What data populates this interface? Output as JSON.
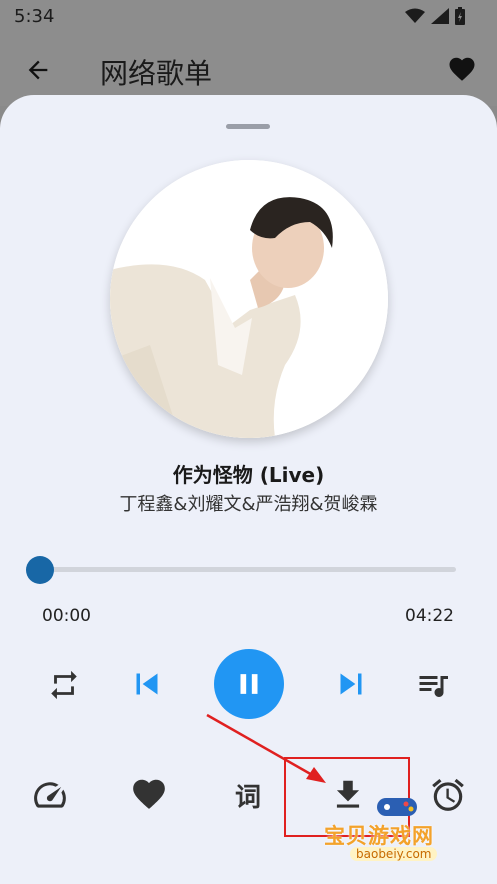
{
  "status": {
    "time": "5:34"
  },
  "header": {
    "title": "网络歌单"
  },
  "song": {
    "title": "作为怪物 (Live)",
    "artist": "丁程鑫&刘耀文&严浩翔&贺峻霖"
  },
  "player": {
    "current_time": "00:00",
    "total_time": "04:22",
    "progress": 0.0
  },
  "actions": {
    "lyrics_label": "词"
  },
  "watermark": {
    "text": "宝贝游戏网",
    "url": "baobeiy.com"
  },
  "colors": {
    "accent": "#2196f3",
    "progress_thumb": "#1867a6",
    "sheet_bg": "#edf0f9",
    "annotation": "#e02020"
  }
}
